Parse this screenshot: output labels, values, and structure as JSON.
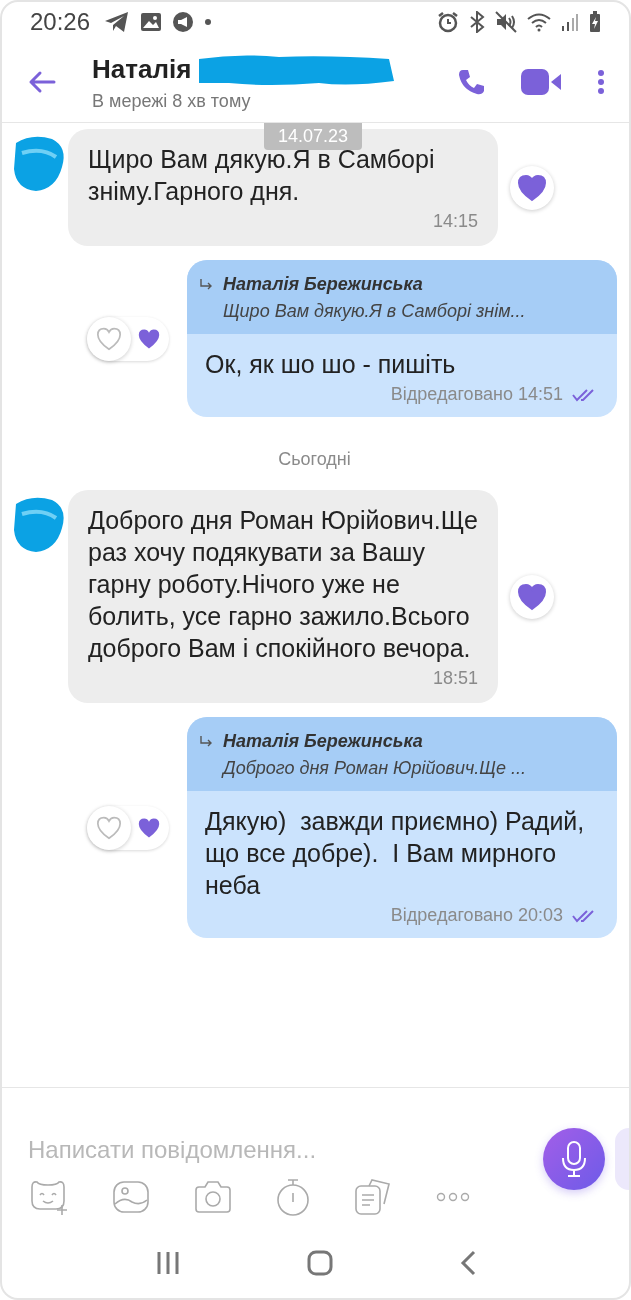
{
  "status_bar": {
    "time": "20:26"
  },
  "header": {
    "name": "Наталія",
    "name_redacted": true,
    "status": "В мережі 8 хв тому"
  },
  "floating_date": "14.07.23",
  "messages": [
    {
      "kind": "incoming",
      "avatar_redacted": true,
      "text": "Щиро Вам дякую.Я в Самборі зніму.Гарного дня.",
      "time": "14:15",
      "liked": true
    },
    {
      "kind": "outgoing",
      "quote_author": "Наталія Бережинська",
      "quote_text": "Щиро Вам дякую.Я в Самборі знім...",
      "text": "Ок, як шо шо - пишіть",
      "edited": "Відредаговано",
      "time": "14:51",
      "read": true,
      "liked": true
    },
    {
      "kind": "date",
      "text": "Сьогодні"
    },
    {
      "kind": "incoming",
      "avatar_redacted": true,
      "text": "Доброго дня Роман Юрійович.Ще раз хочу подякувати за Вашу гарну роботу.Нічого уже не болить, усе гарно зажило.Всього доброго Вам і спокійного вечора.",
      "time": "18:51",
      "liked": true
    },
    {
      "kind": "outgoing",
      "quote_author": "Наталія Бережинська",
      "quote_text": "Доброго дня Роман Юрійович.Ще ...",
      "text": "Дякую)  завжди приємно) Радий, що все добре).  І Вам мирного неба",
      "edited": "Відредаговано",
      "time": "20:03",
      "read": true,
      "liked": true
    }
  ],
  "composer": {
    "placeholder": "Написати повідомлення..."
  }
}
